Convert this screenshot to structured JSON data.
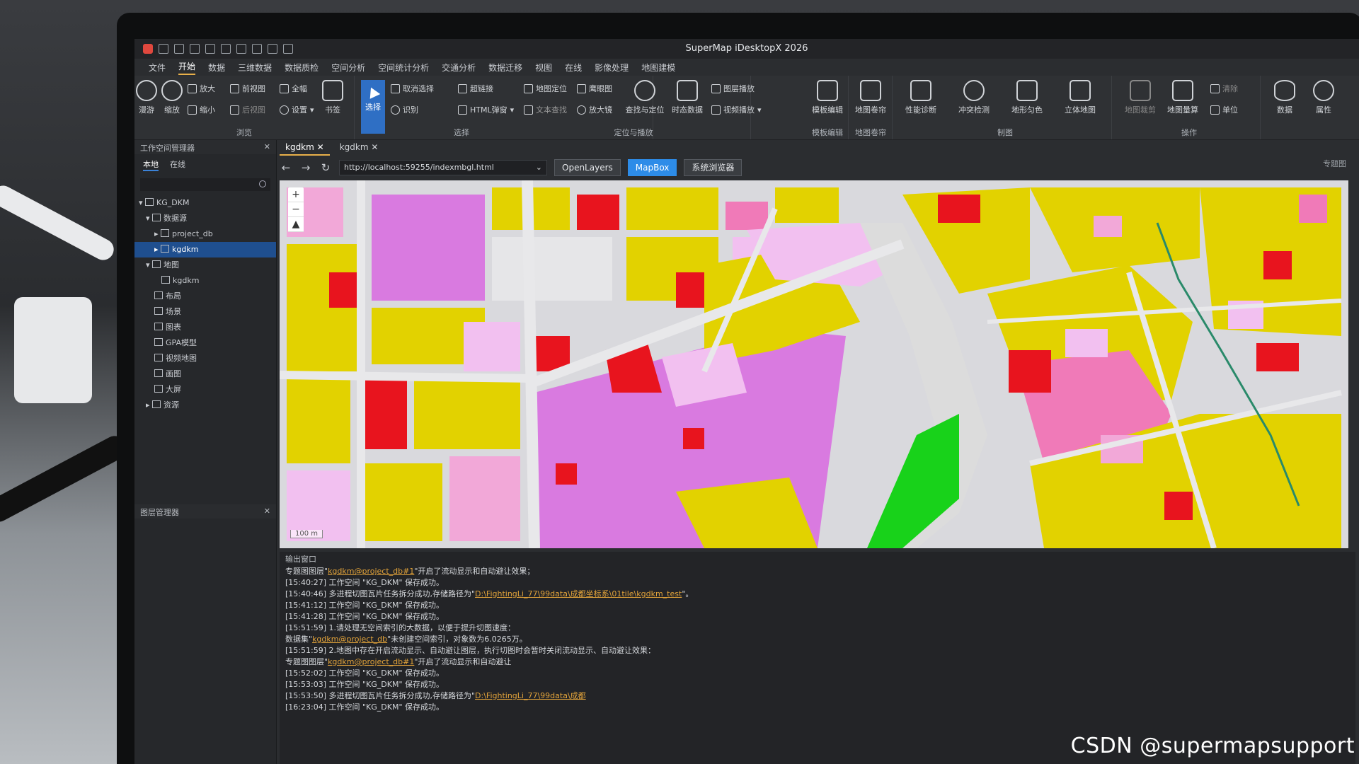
{
  "window": {
    "title": "SuperMap iDesktopX 2026"
  },
  "menu": [
    "文件",
    "开始",
    "数据",
    "三维数据",
    "数据质检",
    "空间分析",
    "空间统计分析",
    "交通分析",
    "数据迁移",
    "视图",
    "在线",
    "影像处理",
    "地图建模"
  ],
  "menu_active": "开始",
  "ribbon": {
    "browse": {
      "title": "浏览",
      "items": [
        "漫游",
        "缩放",
        "放大",
        "缩小",
        "前视图",
        "后视图",
        "全幅",
        "设置",
        "书签"
      ]
    },
    "select": {
      "title": "选择",
      "items": [
        "选择",
        "取消选择",
        "超链接",
        "识别",
        "HTML弹窗"
      ]
    },
    "locate": {
      "title": "定位与播放",
      "items": [
        "地图定位",
        "鹰眼图",
        "图层播放",
        "文本查找",
        "放大镜",
        "查找与定位",
        "时态数据",
        "视频播放"
      ]
    },
    "template": {
      "title": "模板编辑",
      "label": "模板编辑"
    },
    "scroll": {
      "title": "地图卷帘",
      "label": "地图卷帘"
    },
    "draw": {
      "title": "制图",
      "items": [
        "性能诊断",
        "冲突检测",
        "地形匀色",
        "立体地图"
      ]
    },
    "ops": {
      "title": "操作",
      "items": [
        "地图裁剪",
        "地图量算",
        "清除",
        "单位"
      ]
    },
    "data_label": "数据",
    "props_label": "属性"
  },
  "workspace": {
    "title": "工作空间管理器",
    "tabs": [
      "本地",
      "在线"
    ],
    "tree": [
      "KG_DKM",
      "数据源",
      "project_db",
      "kgdkm",
      "地图",
      "kgdkm",
      "布局",
      "场景",
      "图表",
      "GPA模型",
      "视频地图",
      "画图",
      "大屏",
      "资源"
    ],
    "selected": "kgdkm"
  },
  "layers_panel": {
    "title": "图层管理器"
  },
  "doc_tabs": [
    "kgdkm",
    "kgdkm"
  ],
  "browser": {
    "url": "http://localhost:59255/indexmbgl.html",
    "modes": [
      "OpenLayers",
      "MapBox",
      "系统浏览器"
    ],
    "active_mode": "MapBox"
  },
  "right_panel_label": "专题图",
  "map": {
    "scale_label": "100 m",
    "zoom_in": "+",
    "zoom_out": "−"
  },
  "output": {
    "title": "输出窗口",
    "lines": [
      {
        "text": "专题图图层\"",
        "path": "kgdkm@project_db#1",
        "tail": "\"开启了流动显示和自动避让效果；"
      },
      {
        "text": "[15:40:27] 工作空间 \"KG_DKM\" 保存成功。"
      },
      {
        "text": "[15:40:46] 多进程切图瓦片任务拆分成功,存储路径为\"",
        "path": "D:\\FightingLi_77\\99data\\成都坐标系\\01tile\\kgdkm_test",
        "tail": "\"。"
      },
      {
        "text": "[15:41:12] 工作空间 \"KG_DKM\" 保存成功。"
      },
      {
        "text": "[15:41:28] 工作空间 \"KG_DKM\" 保存成功。"
      },
      {
        "text": "[15:51:59] 1.请处理无空间索引的大数据，以便于提升切图速度："
      },
      {
        "text": "数据集\"",
        "path": "kgdkm@project_db",
        "tail": "\"未创建空间索引，对象数为6.0265万。"
      },
      {
        "text": "[15:51:59] 2.地图中存在开启流动显示、自动避让图层，执行切图时会暂时关闭流动显示、自动避让效果："
      },
      {
        "text": "专题图图层\"",
        "path": "kgdkm@project_db#1",
        "tail": "\"开启了流动显示和自动避让"
      },
      {
        "text": "[15:52:02] 工作空间 \"KG_DKM\" 保存成功。"
      },
      {
        "text": "[15:53:03] 工作空间 \"KG_DKM\" 保存成功。"
      },
      {
        "text": "[15:53:50] 多进程切图瓦片任务拆分成功,存储路径为\"",
        "path": "D:\\FightingLi_77\\99data\\成都",
        "tail": ""
      },
      {
        "text": "[16:23:04] 工作空间 \"KG_DKM\" 保存成功。"
      }
    ]
  },
  "watermark": "CSDN @supermapsupport",
  "colors": {
    "accent": "#2d8ce8",
    "commercial": "#e2d200",
    "residential": "#f2c0f0",
    "public": "#d97ae0",
    "business": "#e8141e",
    "green": "#18d21a",
    "road": "#dcdcdc"
  }
}
